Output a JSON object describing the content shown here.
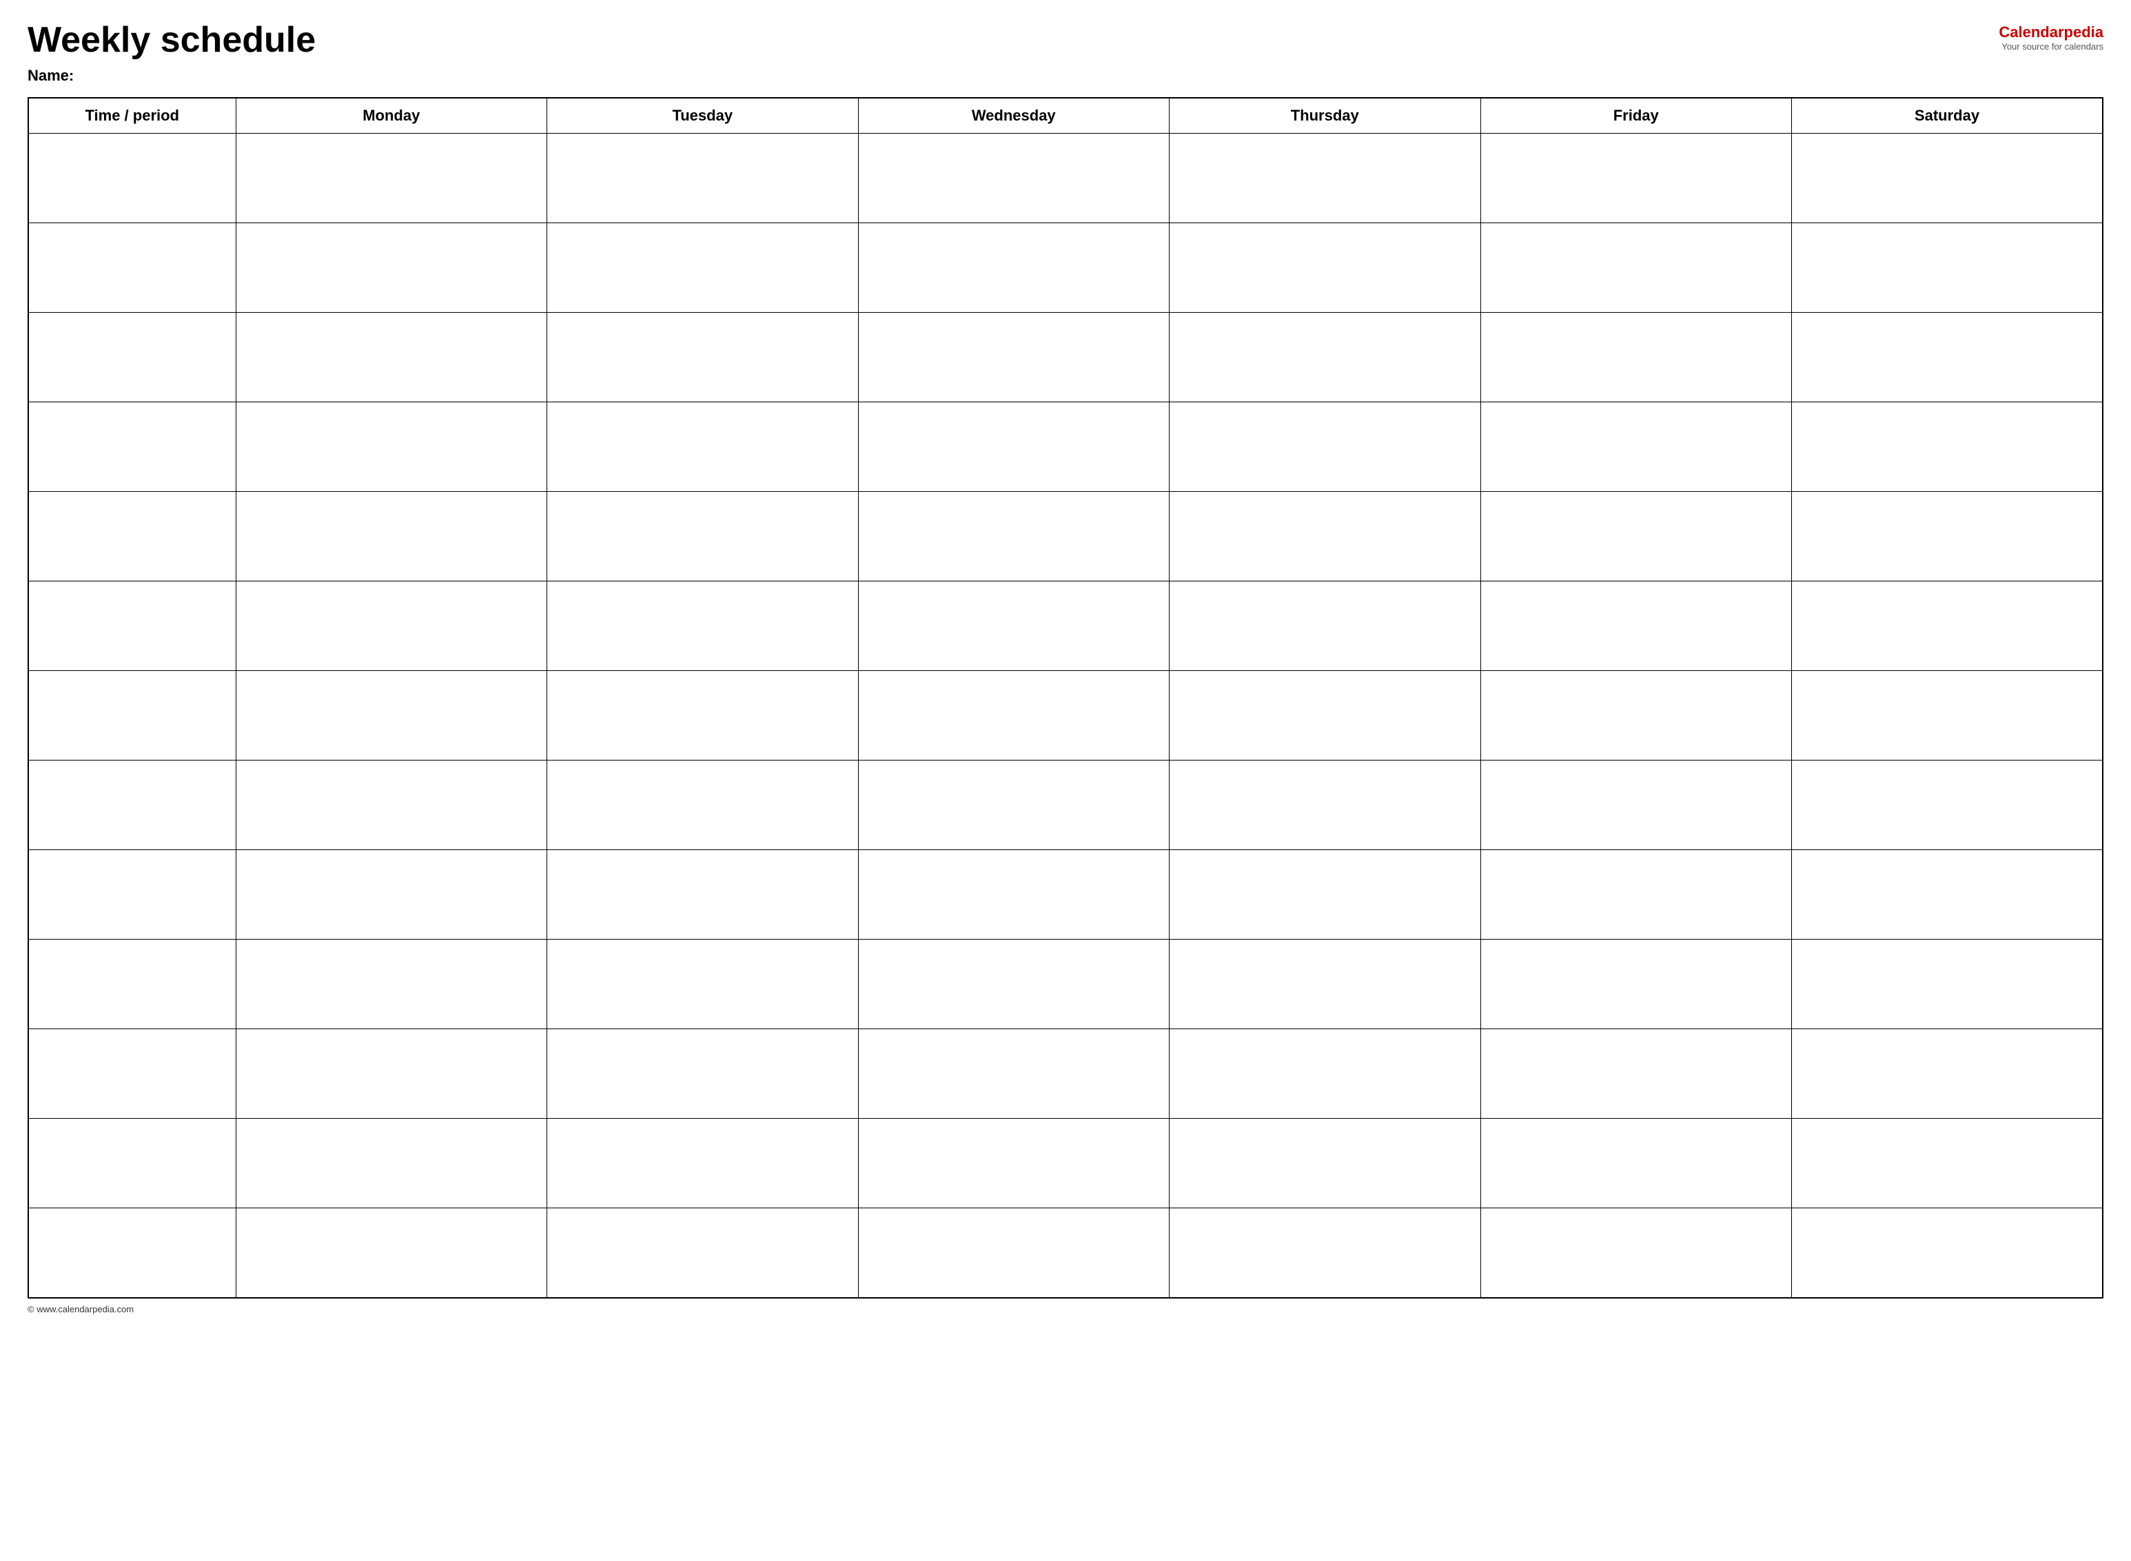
{
  "header": {
    "title": "Weekly schedule",
    "name_label": "Name:",
    "logo_main": "Calendar",
    "logo_accent": "pedia",
    "logo_sub": "Your source for calendars"
  },
  "table": {
    "columns": [
      {
        "key": "time",
        "label": "Time / period"
      },
      {
        "key": "mon",
        "label": "Monday"
      },
      {
        "key": "tue",
        "label": "Tuesday"
      },
      {
        "key": "wed",
        "label": "Wednesday"
      },
      {
        "key": "thu",
        "label": "Thursday"
      },
      {
        "key": "fri",
        "label": "Friday"
      },
      {
        "key": "sat",
        "label": "Saturday"
      }
    ],
    "row_count": 13
  },
  "footer": {
    "text": "© www.calendarpedia.com"
  }
}
